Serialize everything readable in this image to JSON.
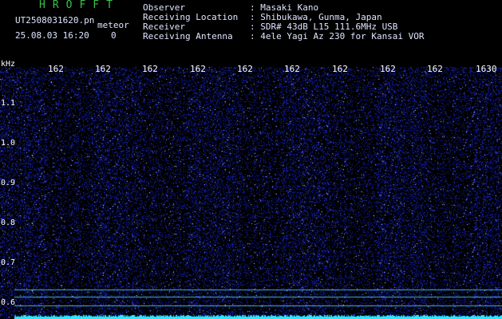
{
  "header": {
    "title": "HROFFT",
    "file_name": "UT2508031620.pn",
    "mode": "meteor",
    "date_time": "25.08.03 16:20",
    "count": "0",
    "info": [
      {
        "key": "Observer",
        "value": ": Masaki Kano"
      },
      {
        "key": "Receiving Location",
        "value": ": Shibukawa, Gunma, Japan"
      },
      {
        "key": "Receiver",
        "value": ": SDR# 43dB L15 111.6MHz USB"
      },
      {
        "key": "Receiving Antenna",
        "value": ": 4ele Yagi Az 230 for Kansai VOR"
      }
    ]
  },
  "spectrogram": {
    "y_unit": "kHz",
    "y_ticks": [
      "1.1",
      "1.0",
      "0.9",
      "0.8",
      "0.7",
      "0.6"
    ],
    "x_ticks": [
      "162",
      "162",
      "162",
      "162",
      "162",
      "162",
      "162",
      "162",
      "162",
      "1630"
    ],
    "colors": {
      "background": "#000000",
      "noise": "#1a2aa8",
      "signal_line": "#4fd2ff",
      "trace": "#2ee6ff"
    }
  }
}
